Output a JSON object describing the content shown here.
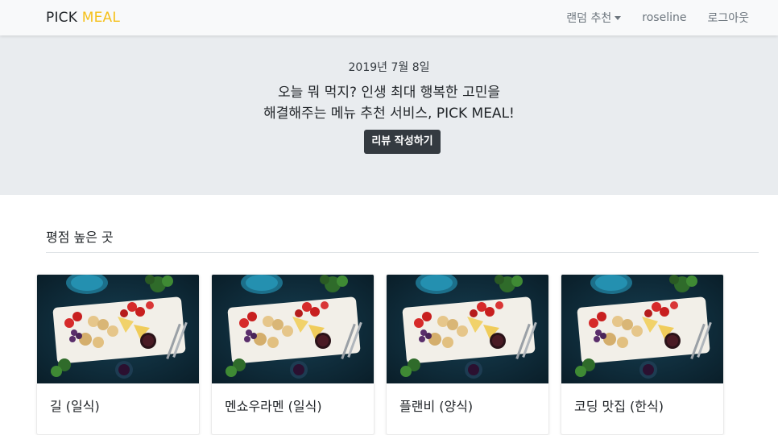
{
  "navbar": {
    "brand_part1": "PICK",
    "brand_part2": "MEAL",
    "links": [
      {
        "label": "랜덤 추천"
      },
      {
        "label": "roseline"
      },
      {
        "label": "로그아웃"
      }
    ]
  },
  "hero": {
    "date": "2019년 7월 8일",
    "line1": "오늘 뭐 먹지? 인생 최대 행복한 고민을",
    "line2": "해결해주는 메뉴 추천 서비스, PICK MEAL!",
    "button_label": "리뷰 작성하기"
  },
  "section": {
    "title": "평점 높은 곳"
  },
  "cards": [
    {
      "title": "길 (일식)"
    },
    {
      "title": "멘쇼우라멘 (일식)"
    },
    {
      "title": "플랜비 (양식)"
    },
    {
      "title": "코딩 맛집 (한식)"
    }
  ],
  "colors": {
    "brand_accent": "#f5c01a",
    "hero_bg": "#e9ecef",
    "button_bg": "#343a40"
  }
}
